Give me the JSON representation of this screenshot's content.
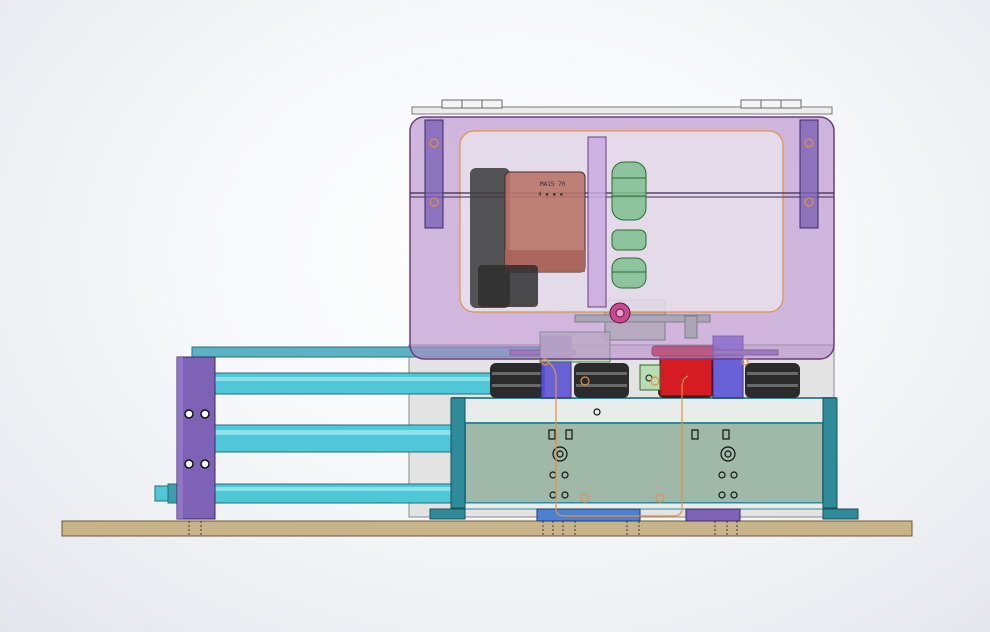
{
  "viewport": {
    "background": "#eef0f4"
  },
  "motor": {
    "label_line1": "MA15 70",
    "label_line2": "4 ▪ ▪ ▪"
  },
  "colors": {
    "base_plate": "#c8b48a",
    "enclosure": "#b489c8",
    "motor_body": "#b9746a",
    "gearbox_band": "#7fbf8f",
    "rod": "#4fc7d6",
    "bracket": "#7d62b5",
    "tank_frame": "#2f8b9a",
    "tank_fill": "#9fb8a8",
    "isolator": "#2b2b2b",
    "red_mount": "#c0161b",
    "highlight_line": "#e39243"
  }
}
